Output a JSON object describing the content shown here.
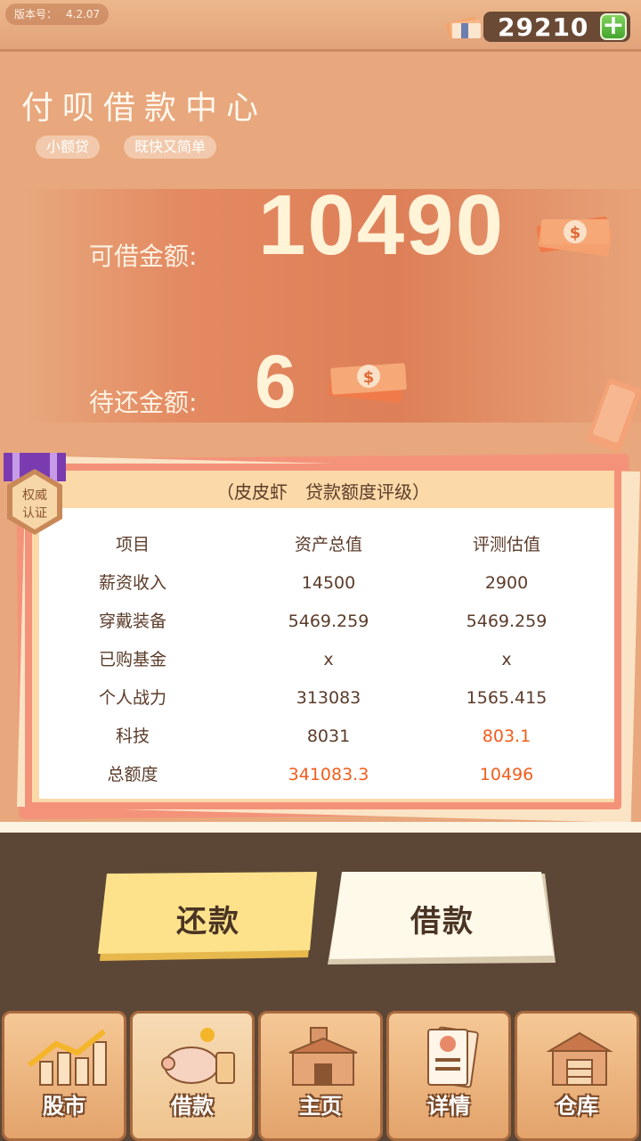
{
  "topbar": {
    "version_label": "版本号：",
    "version_value": "4.2.07",
    "balance": "29210",
    "add_label": "+"
  },
  "header": {
    "title": "付呗借款中心",
    "tags": [
      "小额贷",
      "既快又简单"
    ]
  },
  "amounts": {
    "available_label": "可借金额:",
    "available_value": "10490",
    "due_label": "待还金额:",
    "due_value": "6"
  },
  "badge": {
    "line1": "权威",
    "line2": "认证"
  },
  "rating": {
    "title": "（皮皮虾　贷款额度评级）",
    "headers": [
      "项目",
      "资产总值",
      "评测估值"
    ],
    "rows": [
      {
        "item": "薪资收入",
        "asset": "14500",
        "estimate": "2900"
      },
      {
        "item": "穿戴装备",
        "asset": "5469.259",
        "estimate": "5469.259"
      },
      {
        "item": "已购基金",
        "asset": "x",
        "estimate": "x"
      },
      {
        "item": "个人战力",
        "asset": "313083",
        "estimate": "1565.415"
      },
      {
        "item": "科技",
        "asset": "8031",
        "estimate": "803.1"
      },
      {
        "item": "总额度",
        "asset": "341083.3",
        "estimate": "10496"
      }
    ]
  },
  "actions": {
    "repay": "还款",
    "borrow": "借款"
  },
  "nav": [
    {
      "label": "股市",
      "icon": "stock-chart-icon"
    },
    {
      "label": "借款",
      "icon": "piggy-bank-icon"
    },
    {
      "label": "主页",
      "icon": "home-shop-icon"
    },
    {
      "label": "详情",
      "icon": "profile-card-icon"
    },
    {
      "label": "仓库",
      "icon": "warehouse-icon"
    }
  ],
  "colors": {
    "background": "#e8a77c",
    "accent": "#f25d1c",
    "repay_button": "#fbe08a",
    "borrow_button": "#fff9ea",
    "lower_bg": "#5c4736"
  }
}
